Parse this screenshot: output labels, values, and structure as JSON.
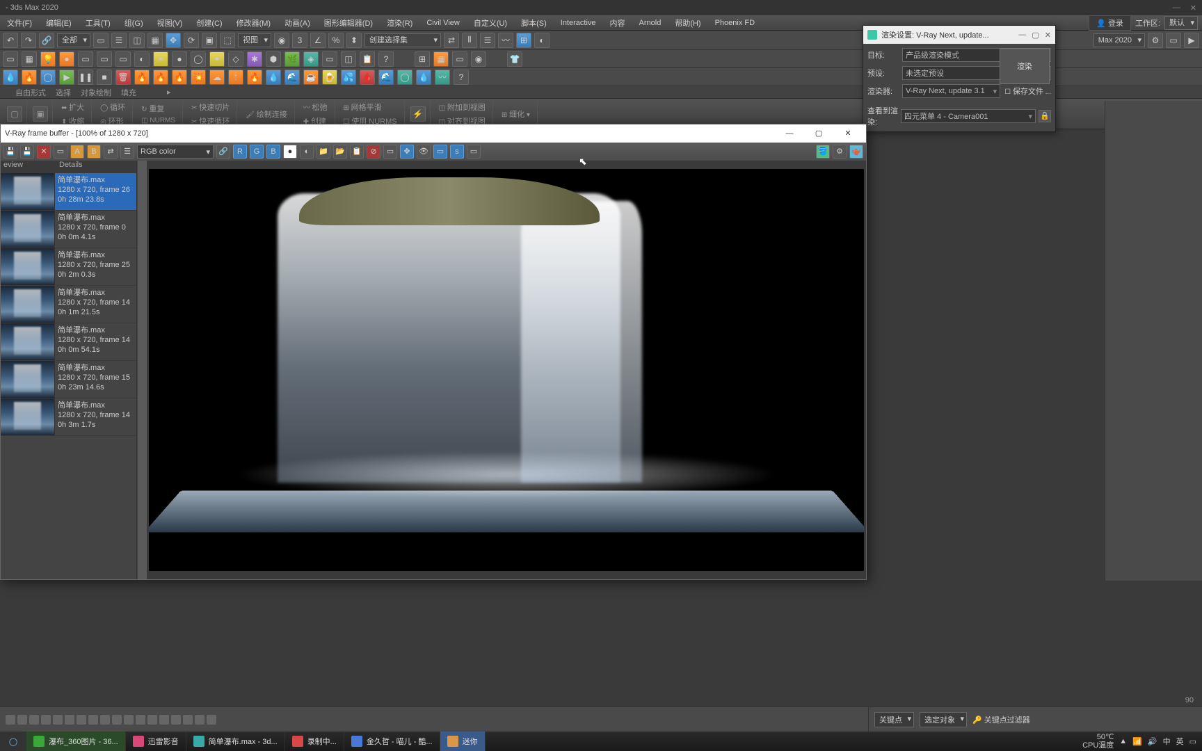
{
  "titlebar": {
    "text": "- 3ds Max 2020"
  },
  "menubar": {
    "items": [
      "文件(F)",
      "编辑(E)",
      "工具(T)",
      "组(G)",
      "视图(V)",
      "创建(C)",
      "修改器(M)",
      "动画(A)",
      "图形编辑器(D)",
      "渲染(R)",
      "Civil View",
      "自定义(U)",
      "脚本(S)",
      "Interactive",
      "内容",
      "Arnold",
      "帮助(H)",
      "Phoenix FD"
    ],
    "login": "登录",
    "workspace": "工作区:",
    "default": "默认"
  },
  "toolbar1": {
    "scope": "全部",
    "createset": "创建选择集",
    "view": "视图",
    "maxver": "Max 2020"
  },
  "ribbonTabs": [
    "自由形式",
    "选择",
    "对象绘制",
    "填充"
  ],
  "ribbon": {
    "expand": "扩大",
    "loop": "循环",
    "shrink": "收缩",
    "ring": "环形",
    "repeat": "重复",
    "quickslice": "快速切片",
    "cut": "快速循环",
    "paint": "绘制连接",
    "relax": "松弛",
    "create": "创建",
    "gridsmooth": "网格平滑",
    "useNurms": "使用 NURMS",
    "attach": "附加到视图",
    "alignview": "对齐到视图",
    "detail": "细化"
  },
  "rsd": {
    "title": "渲染设置: V-Ray Next, update...",
    "target_lbl": "目标:",
    "target_val": "产品级渲染模式",
    "preset_lbl": "预设:",
    "preset_val": "未选定预设",
    "renderer_lbl": "渲染器:",
    "renderer_val": "V-Ray Next, update 3.1",
    "view_lbl": "查看到渲染:",
    "view_val": "四元菜单 4 - Camera001",
    "render_btn": "渲染",
    "save_file": "保存文件"
  },
  "vfb": {
    "title": "V-Ray frame buffer - [100% of 1280 x 720]",
    "channel": "RGB color",
    "hist_hdr_preview": "eview",
    "hist_hdr_details": "Details",
    "history": [
      {
        "name": "简单瀑布.max",
        "res": "1280 x 720, frame 26",
        "time": "0h 28m 23.8s"
      },
      {
        "name": "简单瀑布.max",
        "res": "1280 x 720, frame 0",
        "time": "0h 0m 4.1s"
      },
      {
        "name": "简单瀑布.max",
        "res": "1280 x 720, frame 25",
        "time": "0h 2m 0.3s"
      },
      {
        "name": "简单瀑布.max",
        "res": "1280 x 720, frame 14",
        "time": "0h 1m 21.5s"
      },
      {
        "name": "简单瀑布.max",
        "res": "1280 x 720, frame 14",
        "time": "0h 0m 54.1s"
      },
      {
        "name": "简单瀑布.max",
        "res": "1280 x 720, frame 15",
        "time": "0h 23m 14.6s"
      },
      {
        "name": "简单瀑布.max",
        "res": "1280 x 720, frame 14",
        "time": "0h 3m 1.7s"
      }
    ]
  },
  "timerule": {
    "tick": "90"
  },
  "status": {
    "keymode": "关键点",
    "selobj": "选定对象",
    "keyfilter": "关键点过滤器"
  },
  "taskbar": {
    "items": [
      {
        "label": "瀑布_360图片 - 36...",
        "color": "#38a838"
      },
      {
        "label": "迅雷影音",
        "color": "#d84878"
      },
      {
        "label": "简单瀑布.max - 3d...",
        "color": "#38a8a8"
      },
      {
        "label": "录制中...",
        "color": "#d84848"
      },
      {
        "label": "金久哲 - 喵儿 - 酷...",
        "color": "#4878d8"
      },
      {
        "label": "迷你",
        "color": "#d89848"
      }
    ],
    "temp": "50℃",
    "templbl": "CPU温度"
  }
}
